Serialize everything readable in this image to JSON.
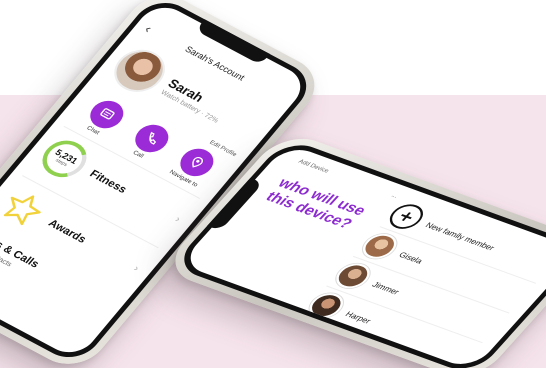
{
  "account_screen": {
    "title": "Sarah's Account",
    "profile": {
      "name": "Sarah",
      "meta": "Watch battery · 72%",
      "edit_label": "Edit Profile"
    },
    "actions": [
      {
        "label": "Chat",
        "icon": "chat-icon"
      },
      {
        "label": "Call",
        "icon": "phone-icon"
      },
      {
        "label": "Navigate to",
        "icon": "location-icon"
      }
    ],
    "fitness": {
      "value": "5,231",
      "unit": "steps",
      "label": "Fitness"
    },
    "awards": {
      "label": "Awards"
    },
    "chats_section": {
      "title": "Chats & Calls",
      "subtitle": "Phone Contacts"
    },
    "colors": {
      "accent": "#9b2bd6",
      "ring": "#8fd14f",
      "star": "#f2d23a"
    }
  },
  "device_screen": {
    "topbar_left": "Add Device",
    "topbar_right": "...",
    "headline": "who will use this device?",
    "members": [
      {
        "name": "New family member",
        "kind": "add"
      },
      {
        "name": "Gisela",
        "kind": "person",
        "color": "#d9a27a"
      },
      {
        "name": "Jimmer",
        "kind": "person",
        "color": "#b88b6a"
      },
      {
        "name": "Harper",
        "kind": "person",
        "color": "#7b4e36"
      }
    ],
    "colors": {
      "accent": "#8c2bd0"
    }
  }
}
